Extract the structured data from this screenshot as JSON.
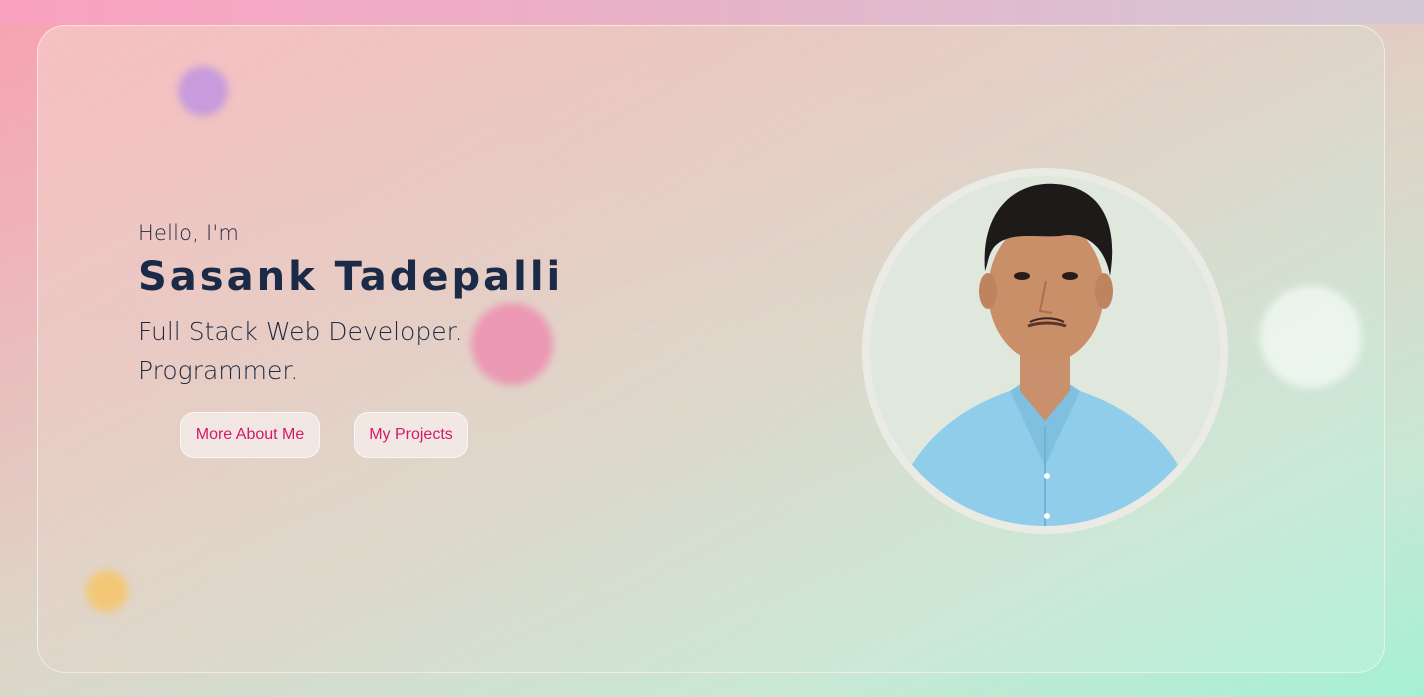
{
  "hero": {
    "greeting": "Hello, I'm",
    "name": "Sasank Tadepalli",
    "role_line_1": "Full Stack Web Developer.",
    "role_line_2": "Programmer."
  },
  "buttons": {
    "about_label": "More About Me",
    "projects_label": "My Projects"
  },
  "colors": {
    "accent": "#d6186a",
    "heading": "#1b2a47"
  },
  "avatar": {
    "icon": "profile-photo"
  }
}
